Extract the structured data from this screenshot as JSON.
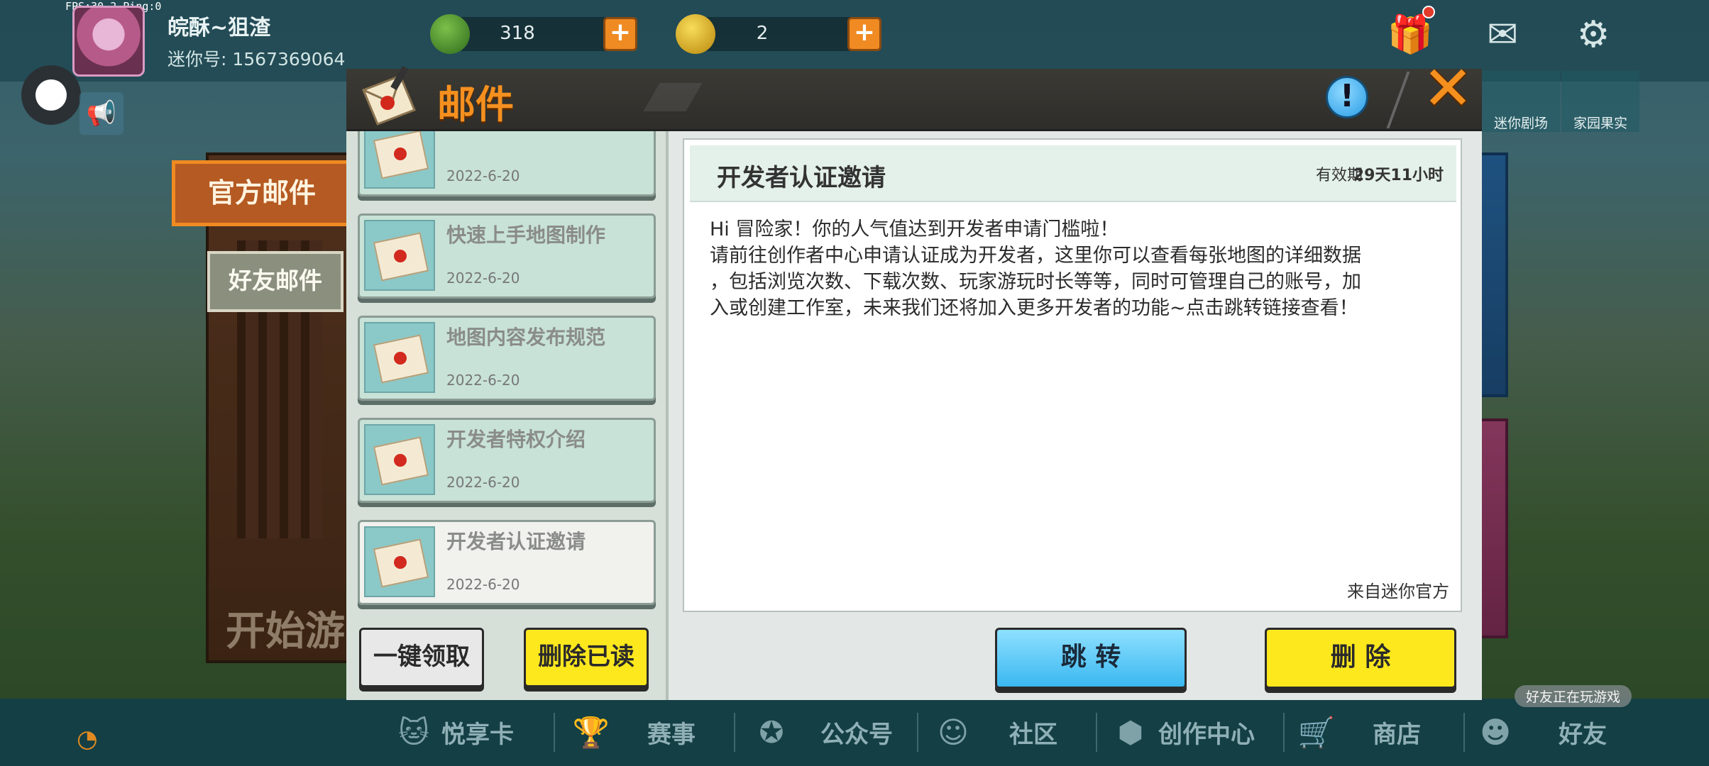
{
  "hud": {
    "fps": "FPS:30.2  Ping:0",
    "username": "皖酥~狙渣",
    "uid": "迷你号: 1567369064",
    "mini_beans": "318",
    "mini_coins": "2",
    "mini_theater": "迷你剧场",
    "home_orchard": "家园果实"
  },
  "side_tabs": {
    "official": "官方邮件",
    "friend": "好友邮件"
  },
  "background": {
    "start_text": "开始游"
  },
  "dialog": {
    "title": "邮件",
    "info_label": "!",
    "close_label": "✕"
  },
  "mail_list": [
    {
      "title": "",
      "date": "2022-6-20"
    },
    {
      "title": "快速上手地图制作",
      "date": "2022-6-20"
    },
    {
      "title": "地图内容发布规范",
      "date": "2022-6-20"
    },
    {
      "title": "开发者特权介绍",
      "date": "2022-6-20"
    },
    {
      "title": "开发者认证邀请",
      "date": "2022-6-20"
    }
  ],
  "list_buttons": {
    "claim_all": "一键领取",
    "delete_read": "删除已读"
  },
  "mail_detail": {
    "title": "开发者认证邀请",
    "expire_label": "有效期：",
    "expire_value": "29天11小时",
    "line1": "Hi 冒险家！你的人气值达到开发者申请门槛啦！",
    "line2": "请前往创作者中心申请认证成为开发者，这里你可以查看每张地图的详细数据",
    "line3": "，包括浏览次数、下载次数、玩家游玩时长等等，同时可管理自己的账号，加",
    "line4": "入或创建工作室，未来我们还将加入更多开发者的功能~点击跳转链接查看！",
    "from": "来自迷你官方"
  },
  "detail_buttons": {
    "jump": "跳 转",
    "delete": "删 除"
  },
  "bottom_nav": [
    {
      "label": "悦享卡",
      "icon": "cat-icon"
    },
    {
      "label": "赛事",
      "icon": "trophy-icon"
    },
    {
      "label": "公众号",
      "icon": "badge-icon"
    },
    {
      "label": "社区",
      "icon": "community-icon"
    },
    {
      "label": "创作中心",
      "icon": "cube-icon"
    },
    {
      "label": "商店",
      "icon": "cart-icon"
    },
    {
      "label": "好友",
      "icon": "friend-icon"
    }
  ],
  "friend_status": "好友正在玩游戏",
  "colors": {
    "accent_orange": "#f5901f",
    "yellow_button": "#fde81e",
    "blue_button": "#3ab8f0",
    "list_item_bg": "#c8e2d8"
  }
}
